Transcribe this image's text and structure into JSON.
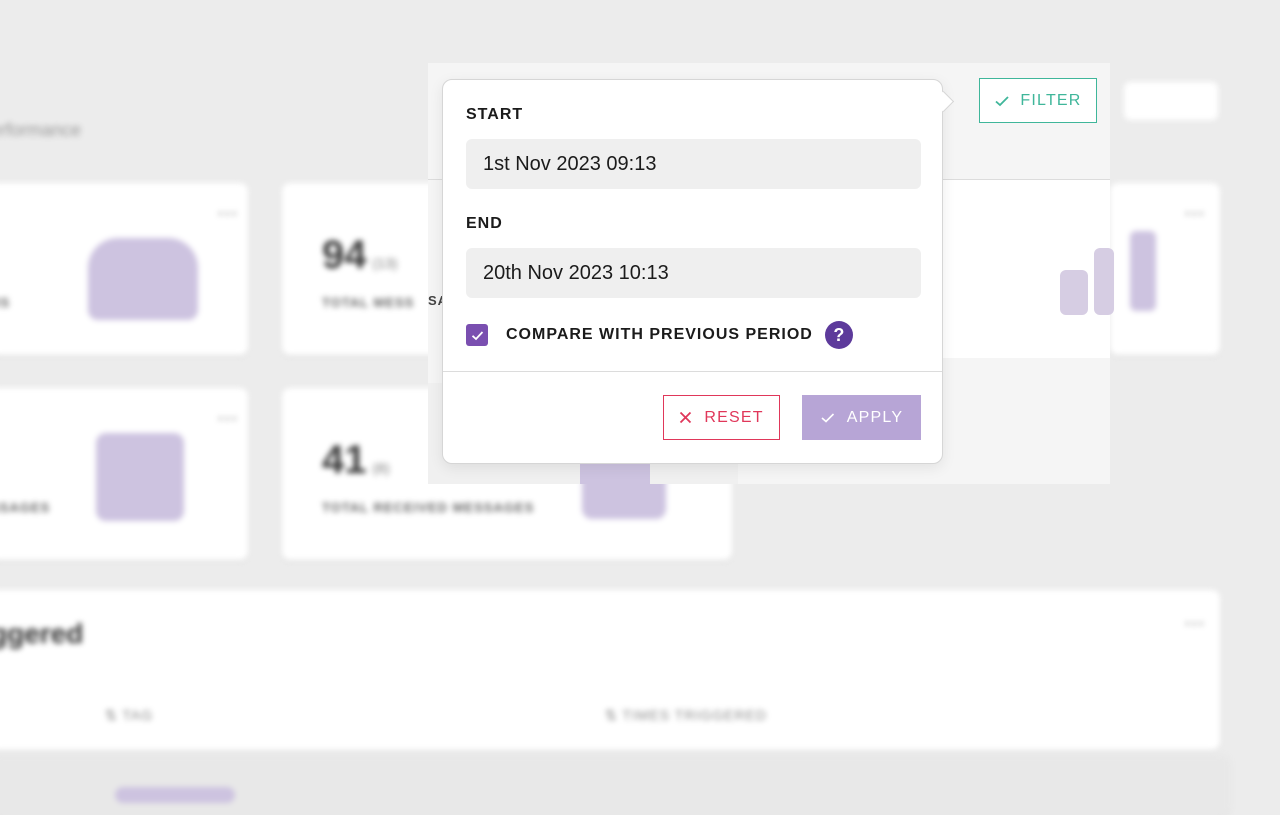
{
  "filter_button": {
    "label": "FILTER",
    "icon": "check-icon",
    "color": "#3fb69a"
  },
  "date_filter": {
    "start_label": "START",
    "start_value": "1st Nov 2023 09:13",
    "end_label": "END",
    "end_value": "20th Nov 2023 10:13",
    "compare_label": "COMPARE WITH PREVIOUS PERIOD",
    "compare_checked": true,
    "help_icon": "question-icon",
    "reset_label": "RESET",
    "apply_label": "APPLY"
  },
  "colors": {
    "accent_purple": "#7a4fb0",
    "reset_red": "#e0375a",
    "apply_disabled": "#b7a5d6"
  }
}
